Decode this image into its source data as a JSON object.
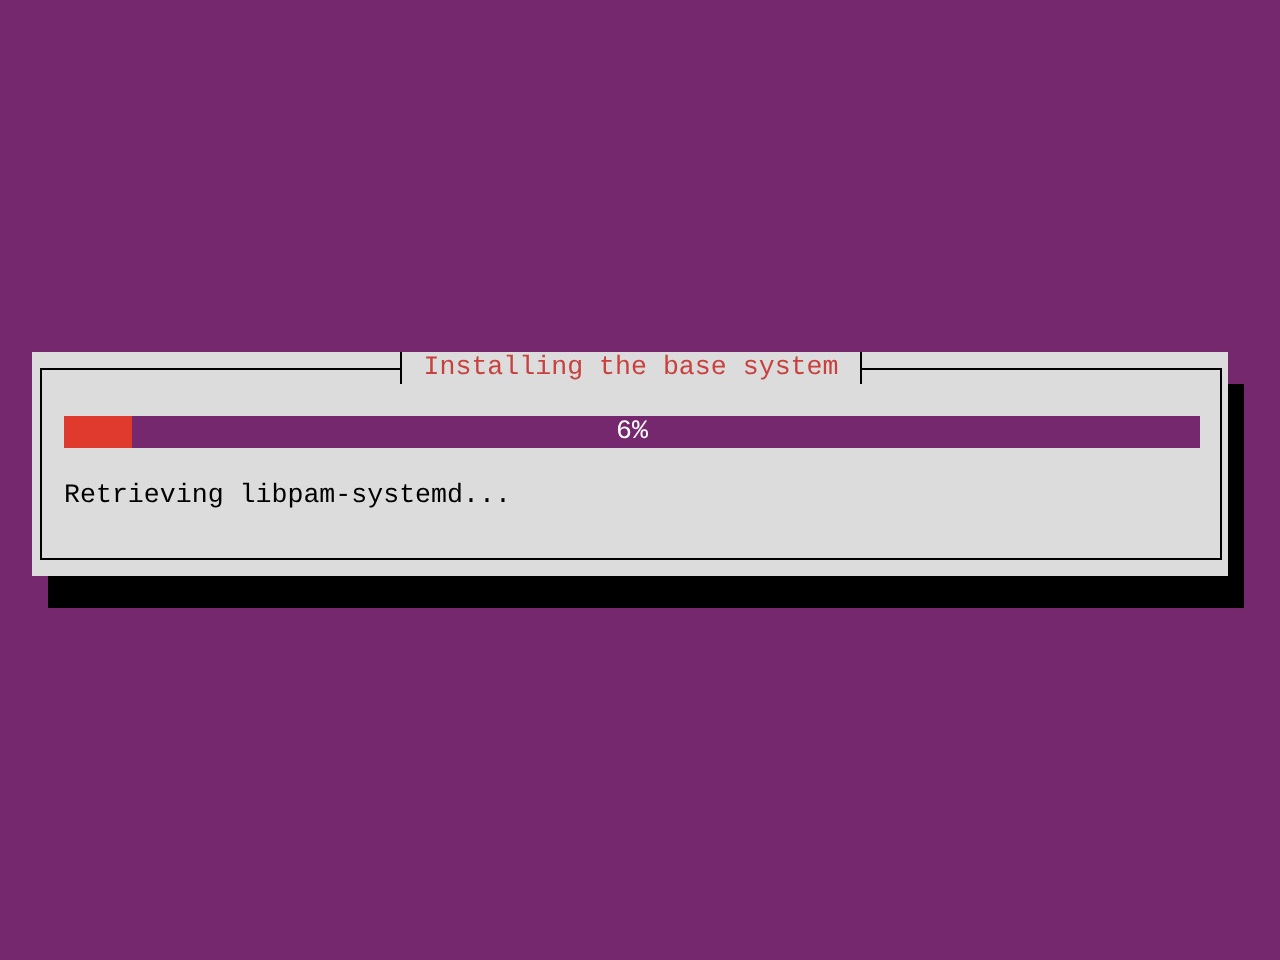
{
  "dialog": {
    "title": "Installing the base system",
    "progress": {
      "level": 0.06,
      "reading": "6%"
    },
    "status": "Retrieving libpam-systemd..."
  }
}
